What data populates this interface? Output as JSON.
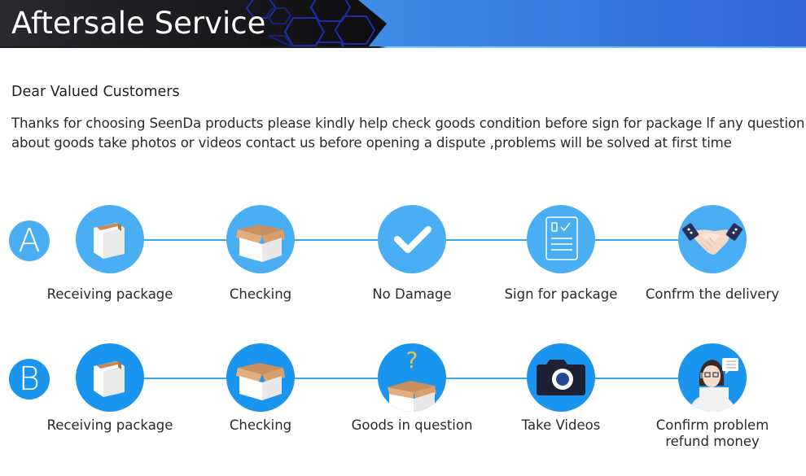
{
  "header": {
    "title": "Aftersale Service",
    "colors": {
      "dark": "#151518",
      "hex_stroke": "#1e2ca8",
      "gradient_start": "#4aaaf7",
      "gradient_end": "#3066d6"
    }
  },
  "intro": {
    "greeting": "Dear Valued Customers",
    "message": "Thanks for choosing SeenDa products please kindly help check goods condition before sign for package lf any question about goods take photos or videos contact us before opening a dispute ,problems will be solved at first time"
  },
  "flows": [
    {
      "badge": "A",
      "color": "#4aaef5",
      "steps": [
        {
          "label": "Receiving package",
          "icon": "closed-box-icon"
        },
        {
          "label": "Checking",
          "icon": "open-box-icon"
        },
        {
          "label": "No Damage",
          "icon": "checkmark-icon"
        },
        {
          "label": "Sign for package",
          "icon": "checklist-document-icon"
        },
        {
          "label": "Confrm the delivery",
          "icon": "handshake-icon"
        }
      ]
    },
    {
      "badge": "B",
      "color": "#1a95ef",
      "steps": [
        {
          "label": "Receiving package",
          "icon": "closed-box-icon"
        },
        {
          "label": "Checking",
          "icon": "open-box-icon"
        },
        {
          "label": "Goods in question",
          "icon": "question-box-icon"
        },
        {
          "label": "Take Videos",
          "icon": "camera-icon"
        },
        {
          "label": "Confirm problem refund money",
          "icon": "support-agent-icon"
        }
      ]
    }
  ],
  "connector_color": "#3aa7e6"
}
